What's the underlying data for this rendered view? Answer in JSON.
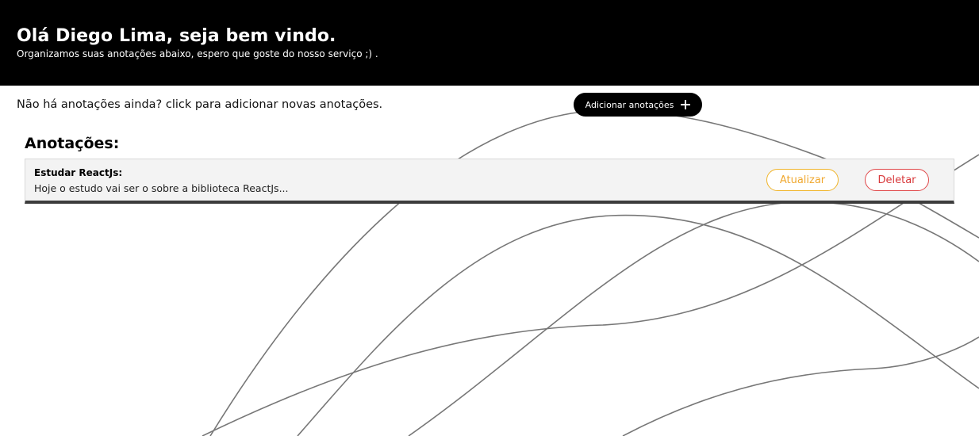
{
  "header": {
    "title": "Olá Diego Lima, seja bem vindo.",
    "subtitle": "Organizamos suas anotações abaixo, espero que goste do nosso serviço ;) ."
  },
  "empty_state": {
    "message": "Não há anotações ainda? click para adicionar novas anotações.",
    "add_button_label": "Adicionar anotações",
    "add_button_icon": "plus-icon"
  },
  "notes_section": {
    "title": "Anotações:",
    "notes": [
      {
        "title": "Estudar ReactJs:",
        "body": "Hoje o estudo vai ser o sobre a biblioteca ReactJs...",
        "update_label": "Atualizar",
        "delete_label": "Deletar"
      }
    ]
  },
  "colors": {
    "header_bg": "#000000",
    "update_accent": "#f0b429",
    "delete_accent": "#e0484a",
    "card_bg": "#f3f3f3",
    "curve_stroke": "#777777"
  }
}
